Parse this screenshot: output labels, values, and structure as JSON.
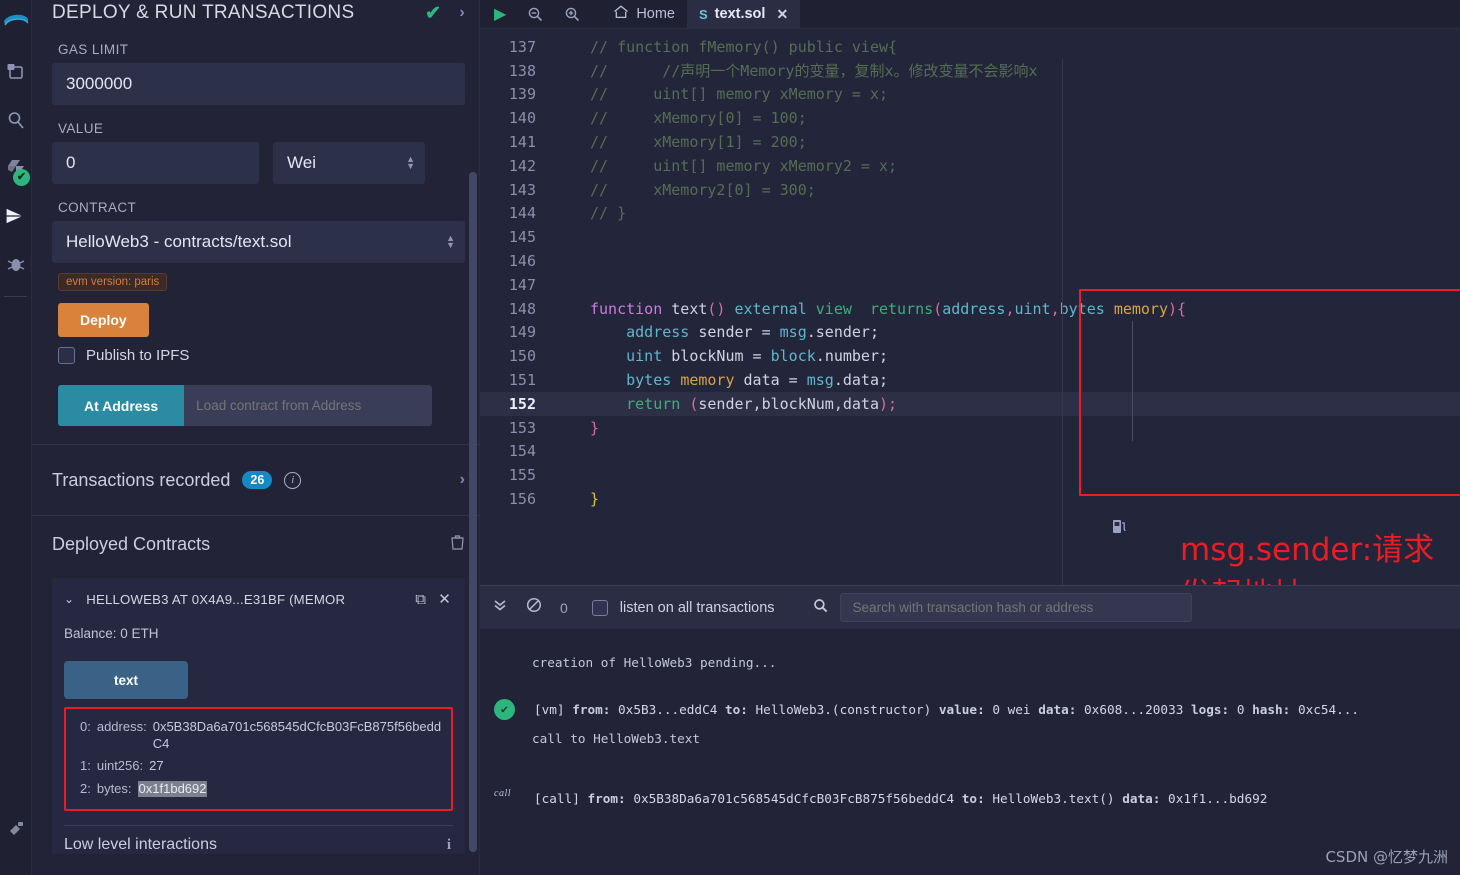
{
  "rail": {
    "items": [
      {
        "name": "remix-logo-icon",
        "glyph": "◗"
      },
      {
        "name": "file-explorer-icon",
        "glyph": "🗎"
      },
      {
        "name": "search-icon",
        "glyph": "⌕"
      },
      {
        "name": "solidity-compiler-icon",
        "glyph": "❖"
      },
      {
        "name": "deploy-run-icon",
        "glyph": "➤"
      },
      {
        "name": "debugger-icon",
        "glyph": "🐞"
      },
      {
        "name": "plugin-manager-icon",
        "glyph": "🔌"
      }
    ]
  },
  "panel": {
    "title": "DEPLOY & RUN TRANSACTIONS",
    "check_icon": "✔",
    "expand_icon": "›",
    "gas_limit_label": "GAS LIMIT",
    "gas_limit_value": "3000000",
    "value_label": "VALUE",
    "value_value": "0",
    "value_unit": "Wei",
    "contract_label": "CONTRACT",
    "contract_value": "HelloWeb3 - contracts/text.sol",
    "evm_version": "evm version: paris",
    "deploy_label": "Deploy",
    "publish_ipfs_label": "Publish to IPFS",
    "at_address_label": "At Address",
    "at_address_placeholder": "Load contract from Address",
    "transactions_recorded_label": "Transactions recorded",
    "transactions_recorded_count": "26",
    "info_icon": "i",
    "chevron_right": "›",
    "deployed_contracts_label": "Deployed Contracts",
    "trash_icon": "🗑"
  },
  "contract_card": {
    "caret": "⌄",
    "title": "HELLOWEB3 AT 0X4A9...E31BF (MEMOR",
    "copy_icon": "⧉",
    "close_icon": "✕",
    "balance": "Balance: 0 ETH",
    "method_button": "text",
    "decoded": [
      {
        "index": "0:",
        "type": "address:",
        "value": "0x5B38Da6a701c568545dCfcB03FcB875f56beddC4",
        "highlight": false
      },
      {
        "index": "1:",
        "type": "uint256:",
        "value": "27",
        "highlight": false
      },
      {
        "index": "2:",
        "type": "bytes:",
        "value": "0x1f1bd692",
        "highlight": true
      }
    ],
    "low_level_label": "Low level interactions",
    "low_level_info": "i"
  },
  "editor": {
    "toolbar": {
      "run_icon": "▶",
      "zoom_out_icon": "⊖",
      "zoom_in_icon": "⊕",
      "home_icon": "⌂",
      "home_label": "Home",
      "tab_icon": "S",
      "tab_label": "text.sol",
      "tab_close": "✕"
    },
    "annotation": "msg.sender:请求发起地址",
    "gas_icon": "⛽",
    "lines": [
      {
        "n": "137",
        "html": "<span class='cm'>// function fMemory() public view{</span>"
      },
      {
        "n": "138",
        "html": "<span class='cm'>//      //声明一个Memory的变量，复制x。修改变量不会影响x</span>"
      },
      {
        "n": "139",
        "html": "<span class='cm'>//     uint[] memory xMemory = x;</span>"
      },
      {
        "n": "140",
        "html": "<span class='cm'>//     xMemory[0] = 100;</span>"
      },
      {
        "n": "141",
        "html": "<span class='cm'>//     xMemory[1] = 200;</span>"
      },
      {
        "n": "142",
        "html": "<span class='cm'>//     uint[] memory xMemory2 = x;</span>"
      },
      {
        "n": "143",
        "html": "<span class='cm'>//     xMemory2[0] = 300;</span>"
      },
      {
        "n": "144",
        "html": "<span class='cm'>// }</span>"
      },
      {
        "n": "145",
        "html": ""
      },
      {
        "n": "146",
        "html": ""
      },
      {
        "n": "147",
        "html": ""
      },
      {
        "n": "148",
        "html": "<span class='kw'>function</span> <span class='id'>text</span><span class='pn'>()</span> <span class='ty'>external</span> <span class='gr'>view</span>  <span class='gr'>returns</span><span class='pn'>(</span><span class='ty'>address</span><span class='pn'>,</span><span class='ty'>uint</span><span class='pn'>,</span><span class='ty'>bytes</span> <span class='sto'>memory</span><span class='pn'>){</span>"
      },
      {
        "n": "149",
        "html": "    <span class='ty'>address</span> <span class='id'>sender</span> = <span class='ty'>msg</span>.<span class='id'>sender</span>;"
      },
      {
        "n": "150",
        "html": "    <span class='ty'>uint</span> <span class='id'>blockNum</span> = <span class='ty'>block</span>.<span class='id'>number</span>;"
      },
      {
        "n": "151",
        "html": "    <span class='ty'>bytes</span> <span class='sto'>memory</span> <span class='id'>data</span> = <span class='ty'>msg</span>.<span class='id'>data</span>;"
      },
      {
        "n": "152",
        "html": "    <span class='gr'>return</span> <span class='pn'>(</span><span class='id'>sender,blockNum,data</span><span class='pn'>);</span>",
        "highlight": true
      },
      {
        "n": "153",
        "html": "<span class='pn'>}</span>"
      },
      {
        "n": "154",
        "html": ""
      },
      {
        "n": "155",
        "html": ""
      },
      {
        "n": "156",
        "html": "<span class='yl'>}</span>"
      }
    ]
  },
  "terminal": {
    "collapse_icon": "⌄⌄",
    "clear_icon": "🚫",
    "pending_count": "0",
    "listen_label": "listen on all transactions",
    "search_icon": "⌕",
    "search_placeholder": "Search with transaction hash or address",
    "logs": [
      {
        "kind": "plain",
        "text": "creation of HelloWeb3 pending..."
      },
      {
        "kind": "vm",
        "status_icon": "✔",
        "html": "[vm] <span class='lbl'>from:</span> 0x5B3...eddC4 <span class='lbl'>to:</span> HelloWeb3.(constructor) <span class='lbl'>value:</span> 0 wei <span class='lbl'>data:</span> 0x608...20033 <span class='lbl'>logs:</span> 0 <span class='lbl'>hash:</span> 0xc54..."
      },
      {
        "kind": "plain",
        "text": "call to HelloWeb3.text"
      },
      {
        "kind": "call",
        "tag": "call",
        "html": "[call] <span class='lbl'>from:</span> 0x5B38Da6a701c568545dCfcB03FcB875f56beddC4 <span class='lbl'>to:</span> HelloWeb3.text() <span class='lbl'>data:</span> 0x1f1...bd692"
      }
    ],
    "watermark": "CSDN @忆梦九洲"
  },
  "colors": {
    "bg": "#222336",
    "panel_bg": "#222336",
    "accent_orange": "#d9823c",
    "accent_teal": "#2b8ba3",
    "accent_blue": "#1589c4",
    "success_green": "#2cb67d",
    "annotation_red": "#ec1c24",
    "method_blue": "#3a6186"
  }
}
